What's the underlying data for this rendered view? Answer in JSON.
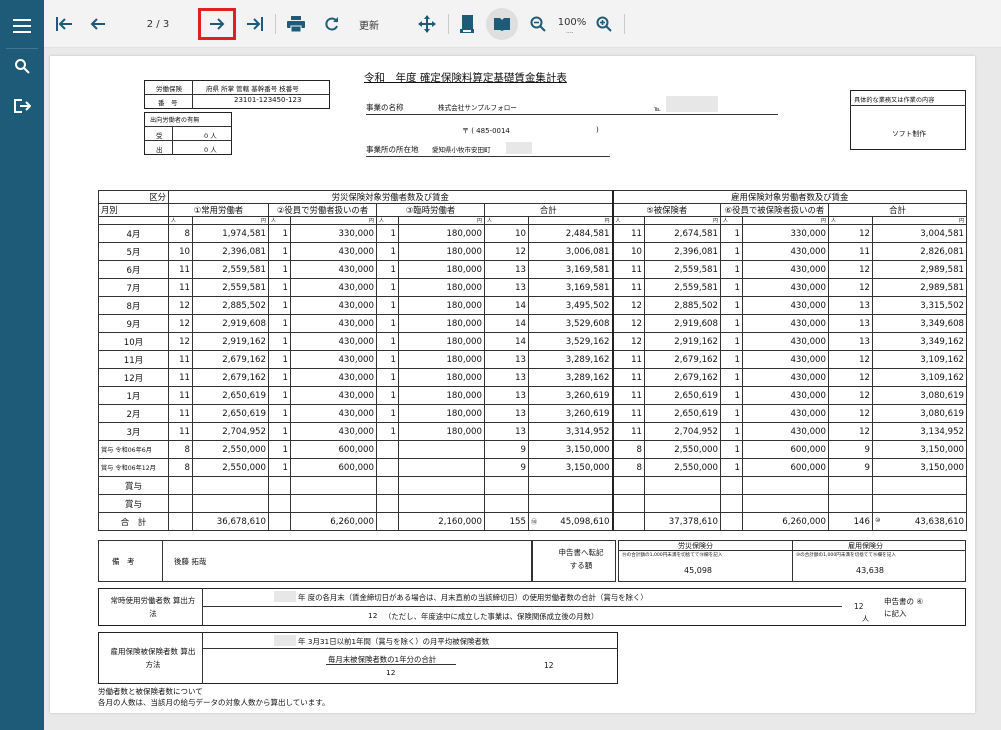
{
  "toolbar": {
    "page_indicator": "2 / 3",
    "update_label": "更新",
    "zoom_level": "100%",
    "zoom_dots": "...."
  },
  "colors": {
    "sidebar": "#1e5b78",
    "highlight": "#e02020"
  },
  "doc": {
    "title": "令和　年度 確定保険料算定基礎賃金集計表",
    "reg_labels": {
      "label_insurance": "労働保険",
      "label_number": "番　号",
      "header_cols": "府県 所掌 管轄 基幹番号 枝番号",
      "number": "23101-123450-123"
    },
    "secondment": {
      "label": "出向労働者の有無",
      "recv_label": "受",
      "send_label": "出",
      "recv_value": "0 人",
      "send_value": "0 人"
    },
    "business": {
      "name_label": "事業の名称",
      "name_value": "株式会社サンプルフォロー",
      "tel_label": "℡",
      "address_label": "事業所の所在地",
      "postal": "〒 ( 485-0014",
      "postal_close": ")",
      "address_value": "愛知県小牧市安田町"
    },
    "work_content": {
      "label": "具体的な業務又は作業の内容",
      "value": "ソフト制作"
    },
    "table": {
      "section_label": "区分",
      "month_label": "月別",
      "rousai_header": "労災保険対象労働者数及び賃金",
      "koyou_header": "雇用保険対象労働者数及び賃金",
      "col1": "①常用労働者",
      "col2": "②役員で労働者扱いの者",
      "col3": "③臨時労働者",
      "col4": "合計",
      "col5": "⑤被保険者",
      "col6": "⑥役員で被保険者扱いの者",
      "col7": "合計",
      "unit_people": "人",
      "unit_yen": "円",
      "rows": [
        [
          "4月",
          "8",
          "1,974,581",
          "1",
          "330,000",
          "1",
          "180,000",
          "10",
          "2,484,581",
          "11",
          "2,674,581",
          "1",
          "330,000",
          "12",
          "3,004,581"
        ],
        [
          "5月",
          "10",
          "2,396,081",
          "1",
          "430,000",
          "1",
          "180,000",
          "12",
          "3,006,081",
          "10",
          "2,396,081",
          "1",
          "430,000",
          "11",
          "2,826,081"
        ],
        [
          "6月",
          "11",
          "2,559,581",
          "1",
          "430,000",
          "1",
          "180,000",
          "13",
          "3,169,581",
          "11",
          "2,559,581",
          "1",
          "430,000",
          "12",
          "2,989,581"
        ],
        [
          "7月",
          "11",
          "2,559,581",
          "1",
          "430,000",
          "1",
          "180,000",
          "13",
          "3,169,581",
          "11",
          "2,559,581",
          "1",
          "430,000",
          "12",
          "2,989,581"
        ],
        [
          "8月",
          "12",
          "2,885,502",
          "1",
          "430,000",
          "1",
          "180,000",
          "14",
          "3,495,502",
          "12",
          "2,885,502",
          "1",
          "430,000",
          "13",
          "3,315,502"
        ],
        [
          "9月",
          "12",
          "2,919,608",
          "1",
          "430,000",
          "1",
          "180,000",
          "14",
          "3,529,608",
          "12",
          "2,919,608",
          "1",
          "430,000",
          "13",
          "3,349,608"
        ],
        [
          "10月",
          "12",
          "2,919,162",
          "1",
          "430,000",
          "1",
          "180,000",
          "14",
          "3,529,162",
          "12",
          "2,919,162",
          "1",
          "430,000",
          "13",
          "3,349,162"
        ],
        [
          "11月",
          "11",
          "2,679,162",
          "1",
          "430,000",
          "1",
          "180,000",
          "13",
          "3,289,162",
          "11",
          "2,679,162",
          "1",
          "430,000",
          "12",
          "3,109,162"
        ],
        [
          "12月",
          "11",
          "2,679,162",
          "1",
          "430,000",
          "1",
          "180,000",
          "13",
          "3,289,162",
          "11",
          "2,679,162",
          "1",
          "430,000",
          "12",
          "3,109,162"
        ],
        [
          "1月",
          "11",
          "2,650,619",
          "1",
          "430,000",
          "1",
          "180,000",
          "13",
          "3,260,619",
          "11",
          "2,650,619",
          "1",
          "430,000",
          "12",
          "3,080,619"
        ],
        [
          "2月",
          "11",
          "2,650,619",
          "1",
          "430,000",
          "1",
          "180,000",
          "13",
          "3,260,619",
          "11",
          "2,650,619",
          "1",
          "430,000",
          "12",
          "3,080,619"
        ],
        [
          "3月",
          "11",
          "2,704,952",
          "1",
          "430,000",
          "1",
          "180,000",
          "13",
          "3,314,952",
          "11",
          "2,704,952",
          "1",
          "430,000",
          "12",
          "3,134,952"
        ],
        [
          "賞与 令和06年6月",
          "8",
          "2,550,000",
          "1",
          "600,000",
          "",
          "",
          "9",
          "3,150,000",
          "8",
          "2,550,000",
          "1",
          "600,000",
          "9",
          "3,150,000"
        ],
        [
          "賞与 令和06年12月",
          "8",
          "2,550,000",
          "1",
          "600,000",
          "",
          "",
          "9",
          "3,150,000",
          "8",
          "2,550,000",
          "1",
          "600,000",
          "9",
          "3,150,000"
        ],
        [
          "賞与",
          "",
          "",
          "",
          "",
          "",
          "",
          "",
          "",
          "",
          "",
          "",
          "",
          "",
          ""
        ],
        [
          "賞与",
          "",
          "",
          "",
          "",
          "",
          "",
          "",
          "",
          "",
          "",
          "",
          "",
          "",
          ""
        ]
      ],
      "total_label": "合　計",
      "total": {
        "c1_yen": "36,678,610",
        "c2_yen": "6,260,000",
        "c3_yen": "2,160,000",
        "c4_n": "155",
        "c4_mark": "⑭",
        "c4_yen": "45,098,610",
        "c5_yen": "37,378,610",
        "c6_yen": "6,260,000",
        "c7_n": "146",
        "c7_mark": "⑩",
        "c7_yen": "43,638,610"
      }
    },
    "remarks": {
      "label": "備　考",
      "value": "後藤 拓哉",
      "transfer_label": "申告書へ転記する額",
      "rousai_label": "労災保険分",
      "rousai_note": "⑭の合計額の1,000円未満を切捨てて⑮欄を記入",
      "rousai_value": "45,098",
      "koyou_label": "雇用保険分",
      "koyou_note": "⑩の合計額の1,000円未満を切捨てて⑯欄を記入",
      "koyou_value": "43,638"
    },
    "regular": {
      "label": "常時使用労働者数 算出方法",
      "line1": "年 度の各月末（賃金締切日がある場合は、月末直前の当該締切日）の使用労働者数の合計（賞与を除く）",
      "line2_num": "12",
      "line2": "（ただし、年度途中に成立した事業は、保険関係成立後の月数）",
      "result": "12",
      "result_unit": "人",
      "note": "申告書の ④に記入"
    },
    "insured": {
      "label": "雇用保険被保険者数 算出方法",
      "line1": "年 3月31日以前1年間（賞与を除く）の月平均被保険者数",
      "line2": "毎月末被保険者数の1年分の合計",
      "line3": "12",
      "result": "12"
    },
    "footer": {
      "line1": "労働者数と被保険者数について",
      "line2": "各月の人数は、当該月の給与データの対象人数から算出しています。"
    }
  }
}
